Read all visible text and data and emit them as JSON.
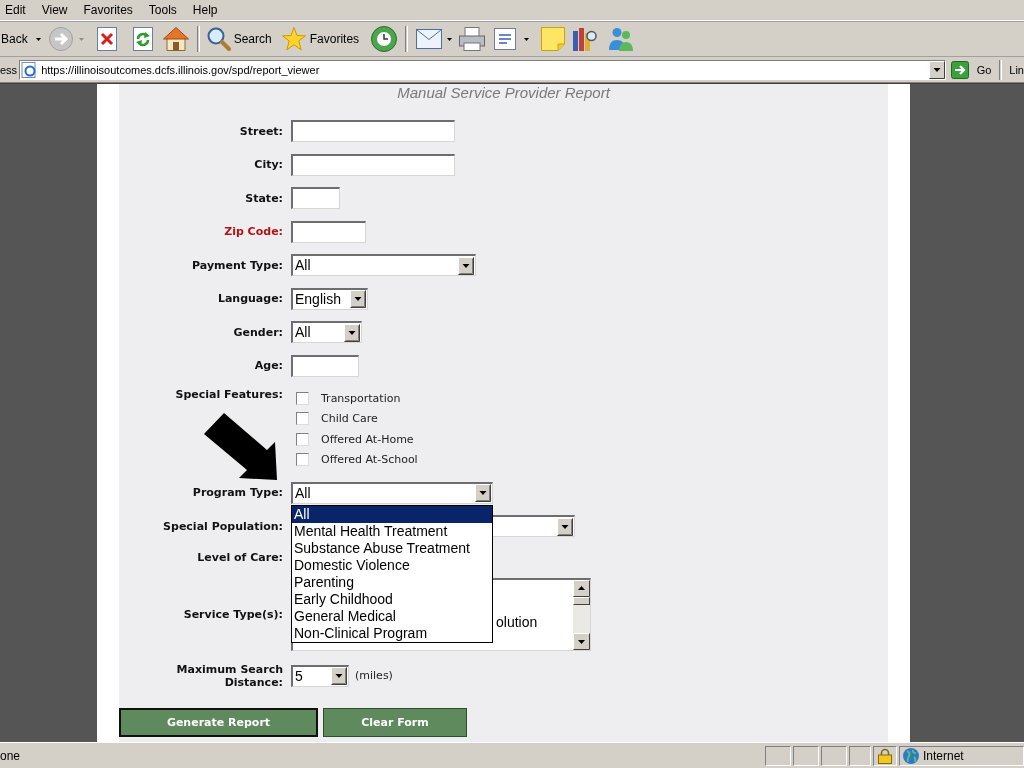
{
  "menu_bar": {
    "items": [
      "Edit",
      "View",
      "Favorites",
      "Tools",
      "Help"
    ]
  },
  "toolbar": {
    "back": {
      "label": "Back"
    },
    "forward": {
      "disabled": true
    },
    "search": {
      "label": "Search"
    },
    "favorites": {
      "label": "Favorites"
    }
  },
  "address_bar": {
    "label": "ess",
    "url": "https://illinoisoutcomes.dcfs.illinois.gov/spd/report_viewer",
    "go_label": "Go",
    "links_label": "Lin"
  },
  "page": {
    "title": "Manual Service Provider Report",
    "fields": [
      {
        "kind": "text",
        "label": "Street:",
        "required": false
      },
      {
        "kind": "text",
        "label": "City:",
        "required": false
      },
      {
        "kind": "text",
        "label": "State:",
        "required": false
      },
      {
        "kind": "text",
        "label": "Zip Code:",
        "required": true
      },
      {
        "kind": "select",
        "label": "Payment Type:",
        "required": false,
        "value": "All"
      },
      {
        "kind": "select",
        "label": "Language:",
        "required": false,
        "value": "English"
      },
      {
        "kind": "select",
        "label": "Gender:",
        "required": false,
        "value": "All"
      },
      {
        "kind": "text",
        "label": "Age:",
        "required": false
      },
      {
        "kind": "checkboxes",
        "label": "Special Features:",
        "required": false,
        "options": [
          {
            "label": "Transportation",
            "checked": false
          },
          {
            "label": "Child Care",
            "checked": false
          },
          {
            "label": "Offered At-Home",
            "checked": false
          },
          {
            "label": "Offered At-School",
            "checked": false
          }
        ]
      },
      {
        "kind": "select",
        "label": "Program Type:",
        "required": false,
        "value": "All",
        "expanded": true,
        "options": [
          {
            "label": "All",
            "selected": true
          },
          {
            "label": "Mental Health Treatment",
            "selected": false
          },
          {
            "label": "Substance Abuse Treatment",
            "selected": false
          },
          {
            "label": "Domestic Violence",
            "selected": false
          },
          {
            "label": "Parenting",
            "selected": false
          },
          {
            "label": "Early Childhood",
            "selected": false
          },
          {
            "label": "General Medical",
            "selected": false
          },
          {
            "label": "Non-Clinical Program",
            "selected": false
          }
        ]
      },
      {
        "kind": "select",
        "label": "Special Population:",
        "required": false
      },
      {
        "kind": "label",
        "label": "Level of Care:",
        "required": false
      },
      {
        "kind": "listbox",
        "label": "Service Type(s):",
        "required": false,
        "items": [
          "olution"
        ]
      },
      {
        "kind": "select",
        "label": "Maximum Search Distance:",
        "required": false,
        "value": "5",
        "suffix": "(miles)"
      }
    ],
    "buttons": [
      {
        "label": "Generate Report",
        "focused": true
      },
      {
        "label": "Clear Form",
        "focused": false
      }
    ]
  },
  "status_bar": {
    "text": "one",
    "secure": true,
    "zone": "Internet"
  }
}
